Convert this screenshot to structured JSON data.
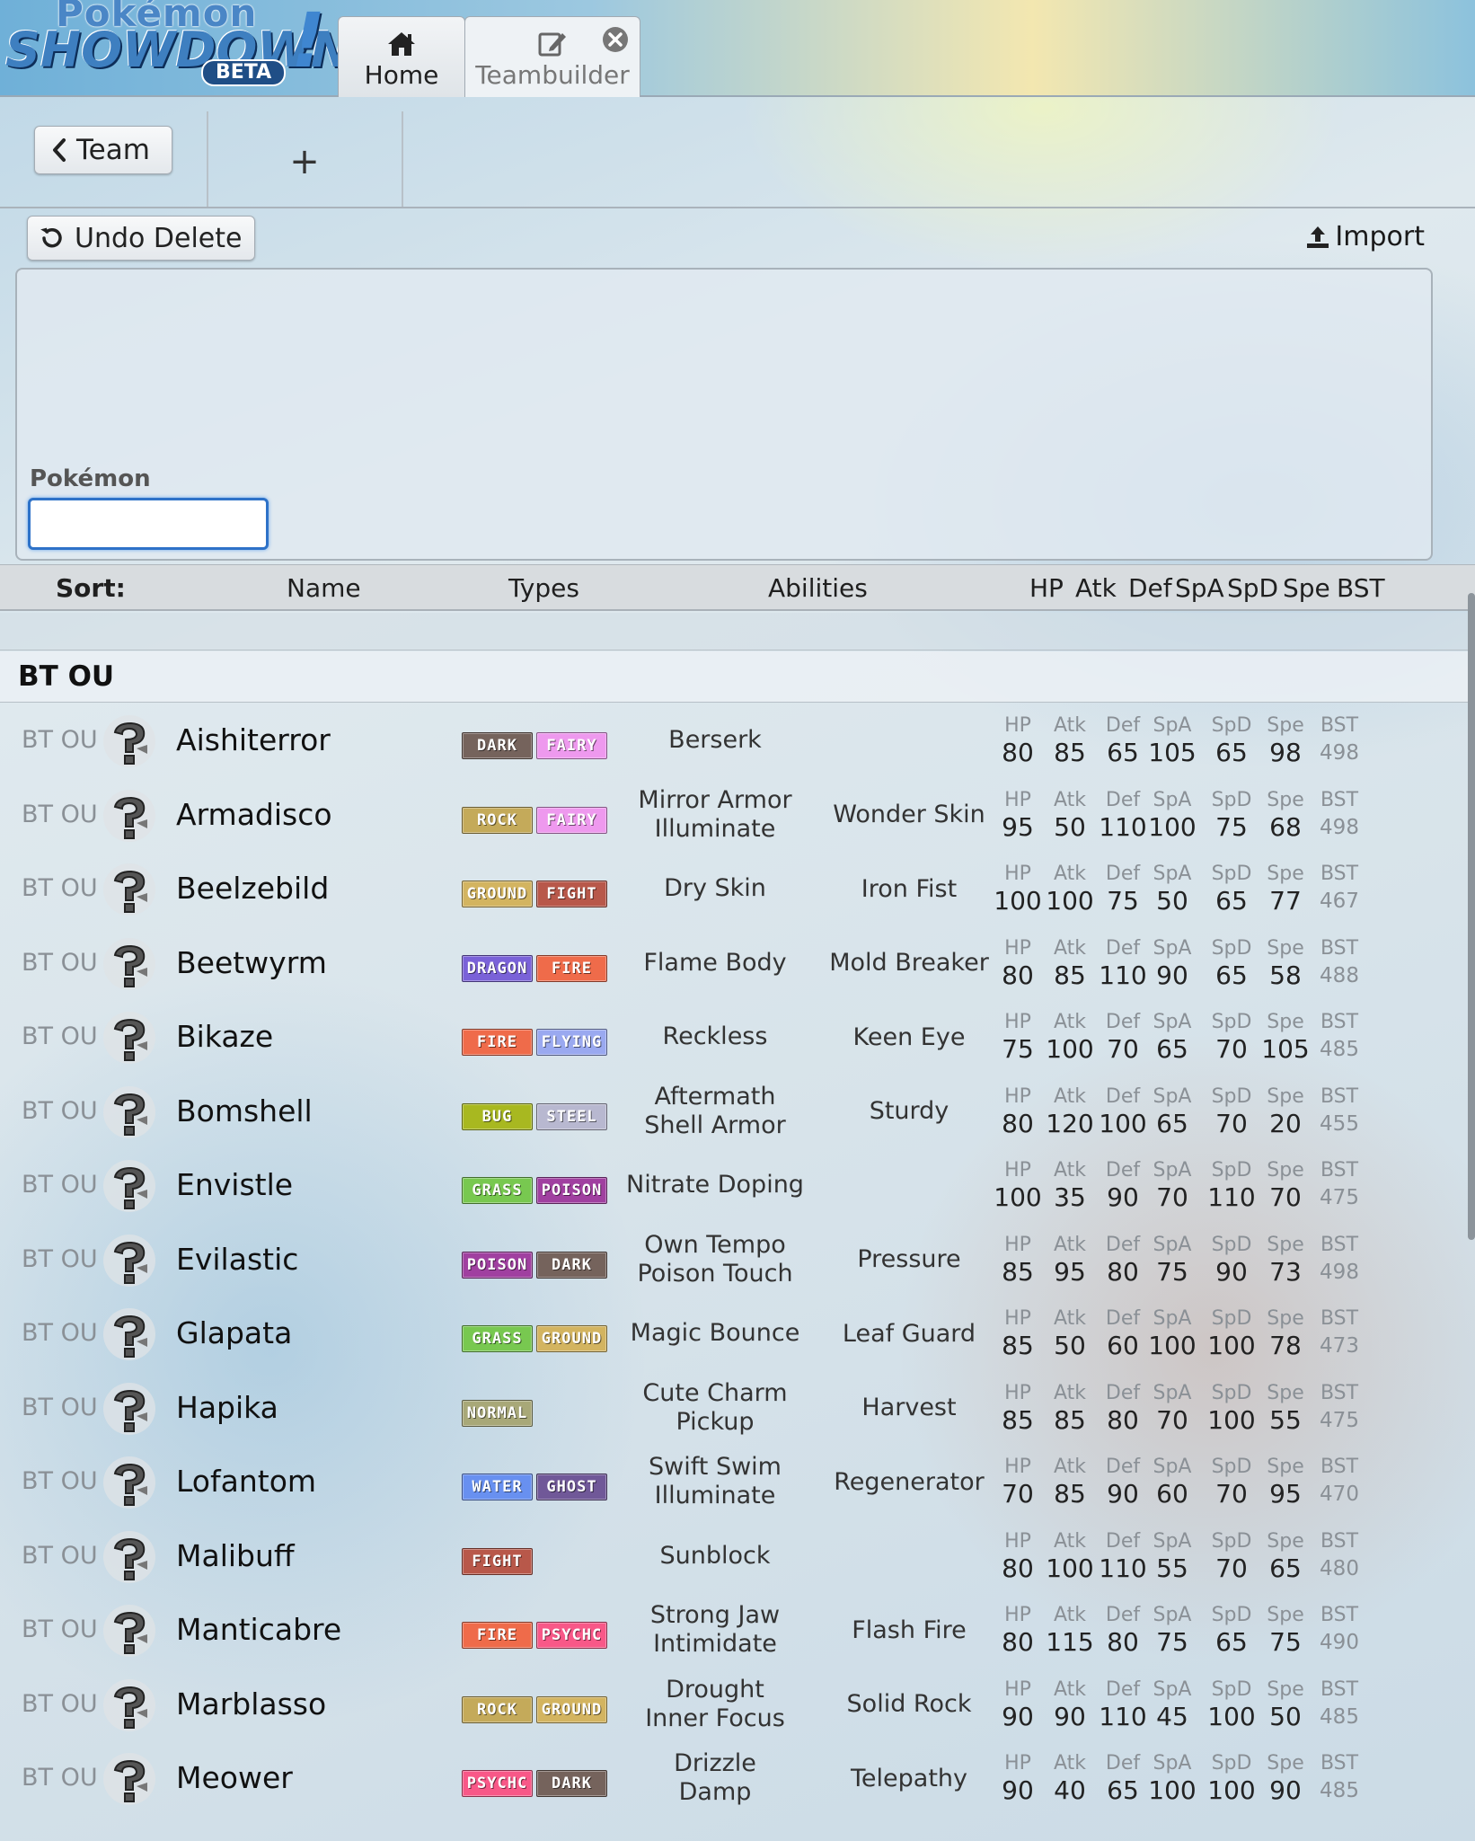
{
  "header": {
    "logo": {
      "line1": "Pokémon",
      "line2": "SHOWDOWN",
      "badge": "BETA",
      "mark": "!"
    },
    "tabs": [
      {
        "label": "Home",
        "icon": "home-icon"
      },
      {
        "label": "Teambuilder",
        "icon": "edit-icon",
        "close_icon": "close-icon"
      }
    ]
  },
  "subbar": {
    "back_label": "Team",
    "add_label": "+"
  },
  "toolbar": {
    "undo_label": "Undo Delete",
    "import_label": "Import"
  },
  "details": {
    "pokemon_label": "Pokémon",
    "pokemon_value": ""
  },
  "sort": {
    "label": "Sort:",
    "columns": [
      "Name",
      "Types",
      "Abilities",
      "HP",
      "Atk",
      "Def",
      "SpA",
      "SpD",
      "Spe",
      "BST"
    ]
  },
  "group": {
    "title": "BT OU"
  },
  "stat_labels": [
    "HP",
    "Atk",
    "Def",
    "SpA",
    "SpD",
    "Spe",
    "BST"
  ],
  "type_colors": {
    "DARK": "#75635c",
    "FAIRY": "#ee99ee",
    "ROCK": "#c4aa5a",
    "GROUND": "#d3b460",
    "FIGHT": "#b8584a",
    "DRAGON": "#7a62d8",
    "FIRE": "#ef6b4a",
    "FLYING": "#9aa9f0",
    "BUG": "#a8b820",
    "STEEL": "#b8b8d0",
    "GRASS": "#78c850",
    "POISON": "#a040a0",
    "NORMAL": "#a8a878",
    "WATER": "#6890f0",
    "GHOST": "#705898",
    "PSYCHC": "#f85888"
  },
  "pokemon": [
    {
      "tier": "BT OU",
      "name": "Aishiterror",
      "types": [
        "DARK",
        "FAIRY"
      ],
      "abilities": [
        "Berserk"
      ],
      "ability2": "",
      "stats": [
        80,
        85,
        65,
        105,
        65,
        98,
        498
      ]
    },
    {
      "tier": "BT OU",
      "name": "Armadisco",
      "types": [
        "ROCK",
        "FAIRY"
      ],
      "abilities": [
        "Mirror Armor",
        "Illuminate"
      ],
      "ability2": "Wonder Skin",
      "stats": [
        95,
        50,
        110,
        100,
        75,
        68,
        498
      ]
    },
    {
      "tier": "BT OU",
      "name": "Beelzebild",
      "types": [
        "GROUND",
        "FIGHT"
      ],
      "abilities": [
        "Dry Skin"
      ],
      "ability2": "Iron Fist",
      "stats": [
        100,
        100,
        75,
        50,
        65,
        77,
        467
      ]
    },
    {
      "tier": "BT OU",
      "name": "Beetwyrm",
      "types": [
        "DRAGON",
        "FIRE"
      ],
      "abilities": [
        "Flame Body"
      ],
      "ability2": "Mold Breaker",
      "stats": [
        80,
        85,
        110,
        90,
        65,
        58,
        488
      ]
    },
    {
      "tier": "BT OU",
      "name": "Bikaze",
      "types": [
        "FIRE",
        "FLYING"
      ],
      "abilities": [
        "Reckless"
      ],
      "ability2": "Keen Eye",
      "stats": [
        75,
        100,
        70,
        65,
        70,
        105,
        485
      ]
    },
    {
      "tier": "BT OU",
      "name": "Bomshell",
      "types": [
        "BUG",
        "STEEL"
      ],
      "abilities": [
        "Aftermath",
        "Shell Armor"
      ],
      "ability2": "Sturdy",
      "stats": [
        80,
        120,
        100,
        65,
        70,
        20,
        455
      ]
    },
    {
      "tier": "BT OU",
      "name": "Envistle",
      "types": [
        "GRASS",
        "POISON"
      ],
      "abilities": [
        "Nitrate Doping"
      ],
      "ability2": "",
      "stats": [
        100,
        35,
        90,
        70,
        110,
        70,
        475
      ]
    },
    {
      "tier": "BT OU",
      "name": "Evilastic",
      "types": [
        "POISON",
        "DARK"
      ],
      "abilities": [
        "Own Tempo",
        "Poison Touch"
      ],
      "ability2": "Pressure",
      "stats": [
        85,
        95,
        80,
        75,
        90,
        73,
        498
      ]
    },
    {
      "tier": "BT OU",
      "name": "Glapata",
      "types": [
        "GRASS",
        "GROUND"
      ],
      "abilities": [
        "Magic Bounce"
      ],
      "ability2": "Leaf Guard",
      "stats": [
        85,
        50,
        60,
        100,
        100,
        78,
        473
      ]
    },
    {
      "tier": "BT OU",
      "name": "Hapika",
      "types": [
        "NORMAL"
      ],
      "abilities": [
        "Cute Charm",
        "Pickup"
      ],
      "ability2": "Harvest",
      "stats": [
        85,
        85,
        80,
        70,
        100,
        55,
        475
      ]
    },
    {
      "tier": "BT OU",
      "name": "Lofantom",
      "types": [
        "WATER",
        "GHOST"
      ],
      "abilities": [
        "Swift Swim",
        "Illuminate"
      ],
      "ability2": "Regenerator",
      "stats": [
        70,
        85,
        90,
        60,
        70,
        95,
        470
      ]
    },
    {
      "tier": "BT OU",
      "name": "Malibuff",
      "types": [
        "FIGHT"
      ],
      "abilities": [
        "Sunblock"
      ],
      "ability2": "",
      "stats": [
        80,
        100,
        110,
        55,
        70,
        65,
        480
      ]
    },
    {
      "tier": "BT OU",
      "name": "Manticabre",
      "types": [
        "FIRE",
        "PSYCHC"
      ],
      "abilities": [
        "Strong Jaw",
        "Intimidate"
      ],
      "ability2": "Flash Fire",
      "stats": [
        80,
        115,
        80,
        75,
        65,
        75,
        490
      ]
    },
    {
      "tier": "BT OU",
      "name": "Marblasso",
      "types": [
        "ROCK",
        "GROUND"
      ],
      "abilities": [
        "Drought",
        "Inner Focus"
      ],
      "ability2": "Solid Rock",
      "stats": [
        90,
        90,
        110,
        45,
        100,
        50,
        485
      ]
    },
    {
      "tier": "BT OU",
      "name": "Meower",
      "types": [
        "PSYCHC",
        "DARK"
      ],
      "abilities": [
        "Drizzle",
        "Damp"
      ],
      "ability2": "Telepathy",
      "stats": [
        90,
        40,
        65,
        100,
        100,
        90,
        485
      ]
    }
  ]
}
